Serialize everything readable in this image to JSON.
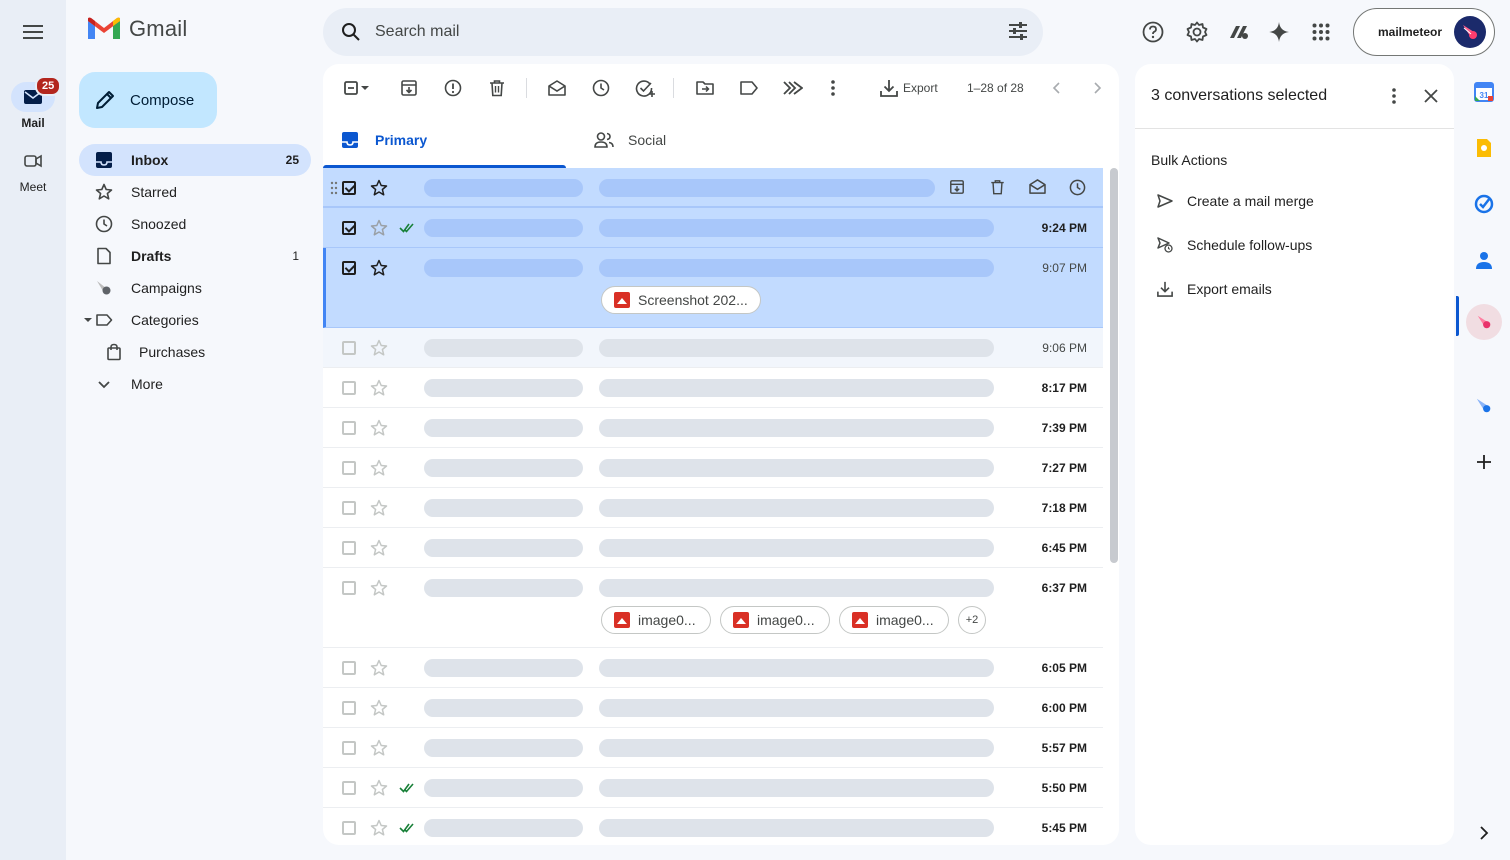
{
  "app": {
    "logo_text": "Gmail"
  },
  "rail": {
    "mail_label": "Mail",
    "mail_badge": "25",
    "meet_label": "Meet"
  },
  "search": {
    "placeholder": "Search mail"
  },
  "account": {
    "name": "mailmeteor"
  },
  "compose": {
    "label": "Compose"
  },
  "nav": {
    "items": [
      {
        "label": "Inbox",
        "count": "25",
        "icon": "inbox-icon"
      },
      {
        "label": "Starred",
        "count": "",
        "icon": "star-icon"
      },
      {
        "label": "Snoozed",
        "count": "",
        "icon": "clock-icon"
      },
      {
        "label": "Drafts",
        "count": "1",
        "icon": "draft-icon"
      },
      {
        "label": "Campaigns",
        "count": "",
        "icon": "meteor-icon"
      },
      {
        "label": "Categories",
        "count": "",
        "icon": "label-icon"
      },
      {
        "label": "Purchases",
        "count": "",
        "icon": "shopping-bag-icon"
      },
      {
        "label": "More",
        "count": "",
        "icon": "chevron-down-icon"
      }
    ]
  },
  "toolbar": {
    "export_label": "Export",
    "pagination": "1–28 of 28"
  },
  "tabs": [
    {
      "label": "Primary",
      "active": true
    },
    {
      "label": "Social",
      "active": false
    }
  ],
  "emails": [
    {
      "time": "",
      "selected": true,
      "attachments": []
    },
    {
      "time": "9:24 PM",
      "selected": true,
      "attachments": []
    },
    {
      "time": "9:07 PM",
      "selected": true,
      "attachments": [
        "Screenshot 202..."
      ]
    },
    {
      "time": "9:06 PM",
      "selected": false,
      "attachments": []
    },
    {
      "time": "8:17 PM",
      "selected": false,
      "attachments": []
    },
    {
      "time": "7:39 PM",
      "selected": false,
      "attachments": []
    },
    {
      "time": "7:27 PM",
      "selected": false,
      "attachments": []
    },
    {
      "time": "7:18 PM",
      "selected": false,
      "attachments": []
    },
    {
      "time": "6:45 PM",
      "selected": false,
      "attachments": []
    },
    {
      "time": "6:37 PM",
      "selected": false,
      "attachments": [
        "image0...",
        "image0...",
        "image0..."
      ],
      "more": "+2"
    },
    {
      "time": "6:05 PM",
      "selected": false,
      "attachments": []
    },
    {
      "time": "6:00 PM",
      "selected": false,
      "attachments": []
    },
    {
      "time": "5:57 PM",
      "selected": false,
      "attachments": []
    },
    {
      "time": "5:50 PM",
      "selected": false,
      "attachments": []
    },
    {
      "time": "5:45 PM",
      "selected": false,
      "attachments": []
    }
  ],
  "side_panel": {
    "title": "3 conversations selected",
    "section_title": "Bulk Actions",
    "actions": [
      "Create a mail merge",
      "Schedule follow-ups",
      "Export emails"
    ]
  },
  "colors": {
    "accent": "#0b57d0",
    "selected_row": "#c2dbff",
    "compose_bg": "#c2e7ff",
    "badge": "#b3261e"
  }
}
